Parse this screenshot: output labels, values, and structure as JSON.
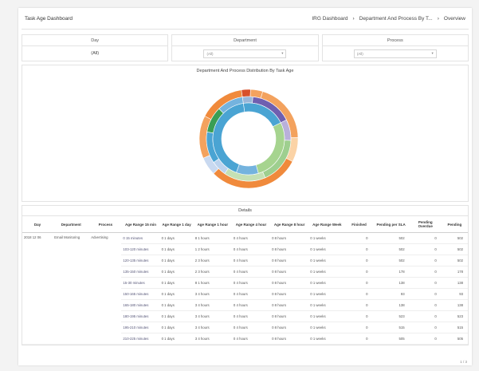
{
  "header": {
    "title": "Task Age Dashboard",
    "crumbs": [
      "IRG Dashboard",
      "Department And Process By T...",
      "Overview"
    ]
  },
  "filters": [
    {
      "label": "Day",
      "value": "(All)"
    },
    {
      "label": "Department",
      "value": "(All)"
    },
    {
      "label": "Process",
      "value": "(All)"
    }
  ],
  "chart_title": "Department And Process Distribution By Task Age",
  "chart_data": {
    "type": "pie",
    "outer_ring": [
      {
        "value": 3,
        "color": "#d8502a"
      },
      {
        "value": 4,
        "color": "#f3a25e"
      },
      {
        "value": 20,
        "color": "#f3a25e"
      },
      {
        "value": 8,
        "color": "#fbd3a6"
      },
      {
        "value": 30,
        "color": "#f08a3c"
      },
      {
        "value": 6,
        "color": "#c9d9f0"
      },
      {
        "value": 14,
        "color": "#f3a25e"
      },
      {
        "value": 15,
        "color": "#f08a3c"
      }
    ],
    "middle_ring": [
      {
        "value": 4,
        "color": "#9ab6d8"
      },
      {
        "value": 16,
        "color": "#6f5fb0"
      },
      {
        "value": 8,
        "color": "#b9b0da"
      },
      {
        "value": 18,
        "color": "#9ecf8f"
      },
      {
        "value": 16,
        "color": "#c5e0b4"
      },
      {
        "value": 6,
        "color": "#bcd3ee"
      },
      {
        "value": 12,
        "color": "#4aa4d3"
      },
      {
        "value": 10,
        "color": "#3a9e54"
      },
      {
        "value": 10,
        "color": "#74b3de"
      }
    ],
    "inner_ring": [
      {
        "value": 20,
        "color": "#4aa4d3"
      },
      {
        "value": 28,
        "color": "#a6d48f"
      },
      {
        "value": 10,
        "color": "#74b3de"
      },
      {
        "value": 42,
        "color": "#4aa4d3"
      }
    ]
  },
  "details": {
    "title": "Details",
    "columns": [
      "Day",
      "Department",
      "Process",
      "Age Range 15 min",
      "Age Range 1 day",
      "Age Range 1 hour",
      "Age Range 4 hour",
      "Age Range 8 hour",
      "Age Range Week",
      "Finished",
      "Pending per SLA",
      "Pending Overdue",
      "Pending"
    ],
    "group": {
      "day": "2018 12 06",
      "department": "Email Monitoring",
      "process": "Advertising"
    },
    "rows": [
      {
        "r15": "0 15 minutes",
        "d1": "0 1 days",
        "h1": "8 1 hours",
        "h4": "0 4 hours",
        "h8": "0 8 hours",
        "wk": "0 1 weeks",
        "fin": "0",
        "sla": "502",
        "ovd": "0",
        "pend": "502"
      },
      {
        "r15": "103-120 minutes",
        "d1": "0 1 days",
        "h1": "1 2 hours",
        "h4": "0 4 hours",
        "h8": "0 8 hours",
        "wk": "0 1 weeks",
        "fin": "0",
        "sla": "502",
        "ovd": "0",
        "pend": "502"
      },
      {
        "r15": "120-135 minutes",
        "d1": "0 1 days",
        "h1": "2 3 hours",
        "h4": "0 4 hours",
        "h8": "0 8 hours",
        "wk": "0 1 weeks",
        "fin": "0",
        "sla": "502",
        "ovd": "0",
        "pend": "502"
      },
      {
        "r15": "135-150 minutes",
        "d1": "0 1 days",
        "h1": "2 3 hours",
        "h4": "0 4 hours",
        "h8": "0 8 hours",
        "wk": "0 1 weeks",
        "fin": "0",
        "sla": "178",
        "ovd": "0",
        "pend": "178"
      },
      {
        "r15": "15-30 minutes",
        "d1": "0 1 days",
        "h1": "8 1 hours",
        "h4": "0 4 hours",
        "h8": "0 8 hours",
        "wk": "0 1 weeks",
        "fin": "0",
        "sla": "138",
        "ovd": "0",
        "pend": "138"
      },
      {
        "r15": "150-165 minutes",
        "d1": "0 1 days",
        "h1": "3 4 hours",
        "h4": "0 4 hours",
        "h8": "0 8 hours",
        "wk": "0 1 weeks",
        "fin": "0",
        "sla": "93",
        "ovd": "0",
        "pend": "93"
      },
      {
        "r15": "165-180 minutes",
        "d1": "0 1 days",
        "h1": "3 4 hours",
        "h4": "0 4 hours",
        "h8": "0 8 hours",
        "wk": "0 1 weeks",
        "fin": "0",
        "sla": "138",
        "ovd": "0",
        "pend": "138"
      },
      {
        "r15": "180-195 minutes",
        "d1": "0 1 days",
        "h1": "3 4 hours",
        "h4": "0 4 hours",
        "h8": "0 8 hours",
        "wk": "0 1 weeks",
        "fin": "0",
        "sla": "523",
        "ovd": "0",
        "pend": "523"
      },
      {
        "r15": "195-210 minutes",
        "d1": "0 1 days",
        "h1": "3 4 hours",
        "h4": "0 4 hours",
        "h8": "0 8 hours",
        "wk": "0 1 weeks",
        "fin": "0",
        "sla": "515",
        "ovd": "0",
        "pend": "515"
      },
      {
        "r15": "210-225 minutes",
        "d1": "0 1 days",
        "h1": "3 4 hours",
        "h4": "0 4 hours",
        "h8": "0 8 hours",
        "wk": "0 1 weeks",
        "fin": "0",
        "sla": "505",
        "ovd": "0",
        "pend": "505"
      }
    ]
  },
  "pager": "1 / 3"
}
